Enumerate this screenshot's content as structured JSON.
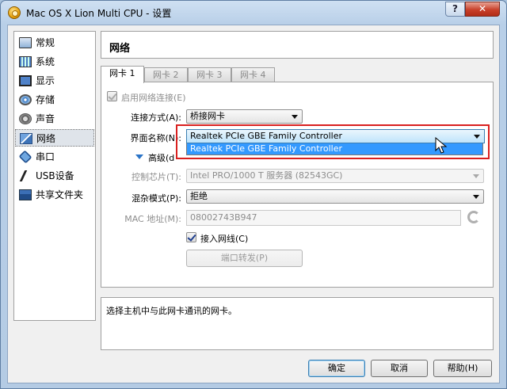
{
  "window": {
    "title": "Mac OS X Lion Multi CPU - 设置",
    "help_glyph": "?",
    "close_glyph": "✕"
  },
  "sidebar": {
    "items": [
      {
        "label": "常规",
        "icon": "general-icon"
      },
      {
        "label": "系统",
        "icon": "system-icon"
      },
      {
        "label": "显示",
        "icon": "display-icon"
      },
      {
        "label": "存储",
        "icon": "storage-icon"
      },
      {
        "label": "声音",
        "icon": "audio-icon"
      },
      {
        "label": "网络",
        "icon": "network-icon",
        "selected": true
      },
      {
        "label": "串口",
        "icon": "serial-port-icon"
      },
      {
        "label": "USB设备",
        "icon": "usb-icon"
      },
      {
        "label": "共享文件夹",
        "icon": "shared-folder-icon"
      }
    ]
  },
  "page": {
    "title": "网络"
  },
  "tabs": [
    {
      "label": "网卡 1",
      "active": true
    },
    {
      "label": "网卡 2"
    },
    {
      "label": "网卡 3"
    },
    {
      "label": "网卡 4"
    }
  ],
  "adapter": {
    "enable_label": "启用网络连接(E)",
    "attached_label": "连接方式(A):",
    "attached_value": "桥接网卡",
    "name_label": "界面名称(N):",
    "name_value": "Realtek PCIe GBE Family Controller",
    "name_options": [
      "Realtek PCIe GBE Family Controller"
    ],
    "advanced_label": "高级(d",
    "chip_label": "控制芯片(T):",
    "chip_value": "Intel PRO/1000 T 服务器 (82543GC)",
    "promisc_label": "混杂模式(P):",
    "promisc_value": "拒绝",
    "mac_label": "MAC 地址(M):",
    "mac_value": "08002743B947",
    "cable_label": "接入网线(C)",
    "port_forward_label": "端口转发(P)"
  },
  "description": "选择主机中与此网卡通讯的网卡。",
  "buttons": {
    "ok": "确定",
    "cancel": "取消",
    "help": "帮助(H)"
  },
  "colors": {
    "highlight": "#3399ff",
    "annotation_border": "#d9201f"
  }
}
